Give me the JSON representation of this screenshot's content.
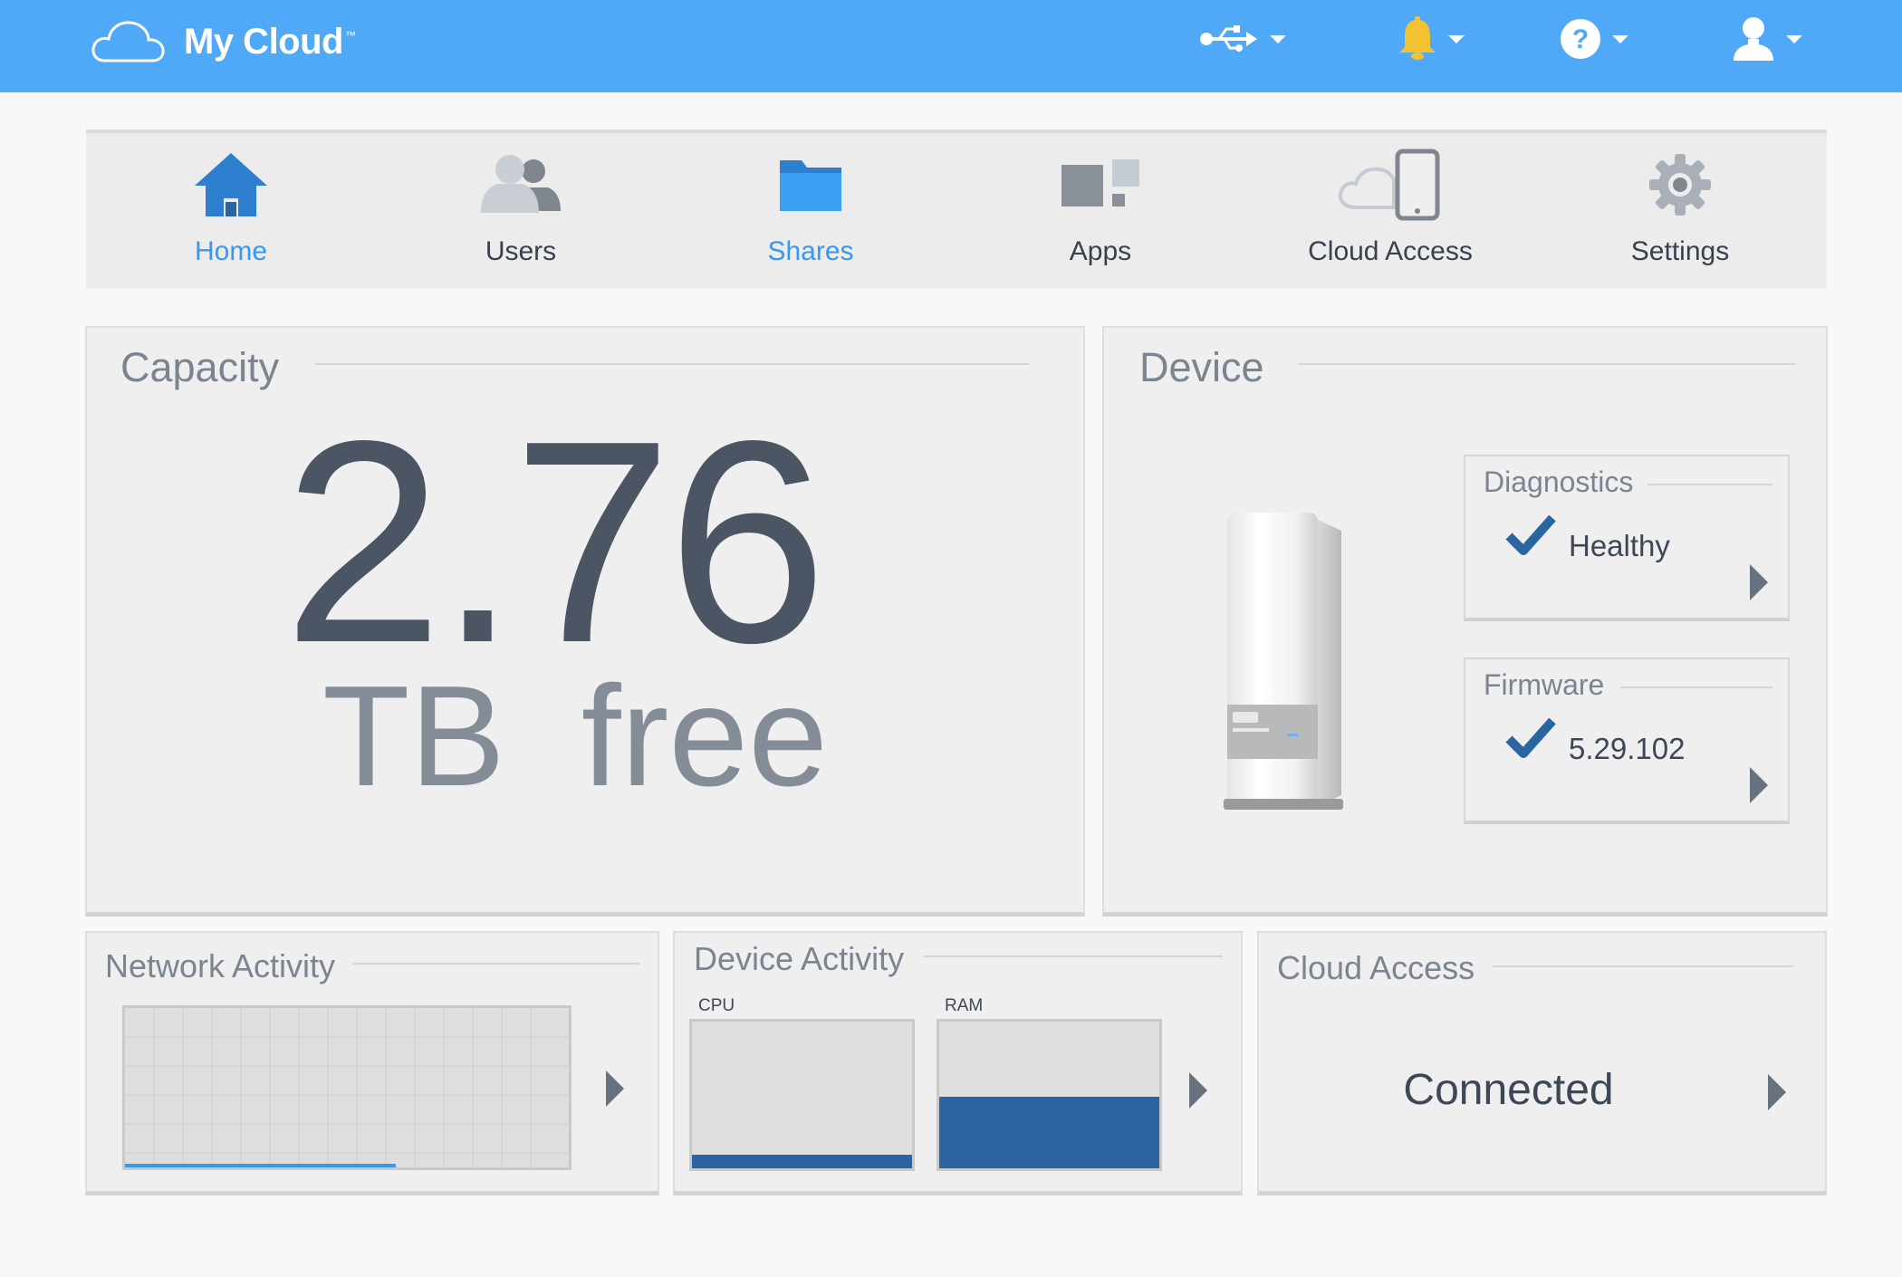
{
  "header": {
    "app_title": "My Cloud",
    "trademark": "™",
    "controls": [
      {
        "name": "usb-menu",
        "icon": "usb-icon"
      },
      {
        "name": "notifications-menu",
        "icon": "bell-icon"
      },
      {
        "name": "help-menu",
        "icon": "help-icon"
      },
      {
        "name": "account-menu",
        "icon": "user-icon"
      }
    ]
  },
  "nav": {
    "items": [
      {
        "label": "Home",
        "icon": "home-icon",
        "active": true
      },
      {
        "label": "Users",
        "icon": "users-icon",
        "active": false
      },
      {
        "label": "Shares",
        "icon": "folder-icon",
        "active": true
      },
      {
        "label": "Apps",
        "icon": "apps-icon",
        "active": false
      },
      {
        "label": "Cloud Access",
        "icon": "cloud-device-icon",
        "active": false
      },
      {
        "label": "Settings",
        "icon": "gear-icon",
        "active": false
      }
    ]
  },
  "capacity": {
    "title": "Capacity",
    "value": "2.76",
    "unit": "TB free"
  },
  "device": {
    "title": "Device",
    "diagnostics": {
      "title": "Diagnostics",
      "status": "Healthy"
    },
    "firmware": {
      "title": "Firmware",
      "version": "5.29.102"
    }
  },
  "network_activity": {
    "title": "Network Activity",
    "level_fraction": 0.61
  },
  "device_activity": {
    "title": "Device Activity",
    "cpu_label": "CPU",
    "cpu_fraction": 0.09,
    "ram_label": "RAM",
    "ram_fraction": 0.49
  },
  "cloud_access": {
    "title": "Cloud Access",
    "status": "Connected"
  },
  "colors": {
    "topbar": "#4fa9f7",
    "accent": "#3897ef",
    "meter_fill": "#2a65a2",
    "check": "#2a65a2"
  }
}
